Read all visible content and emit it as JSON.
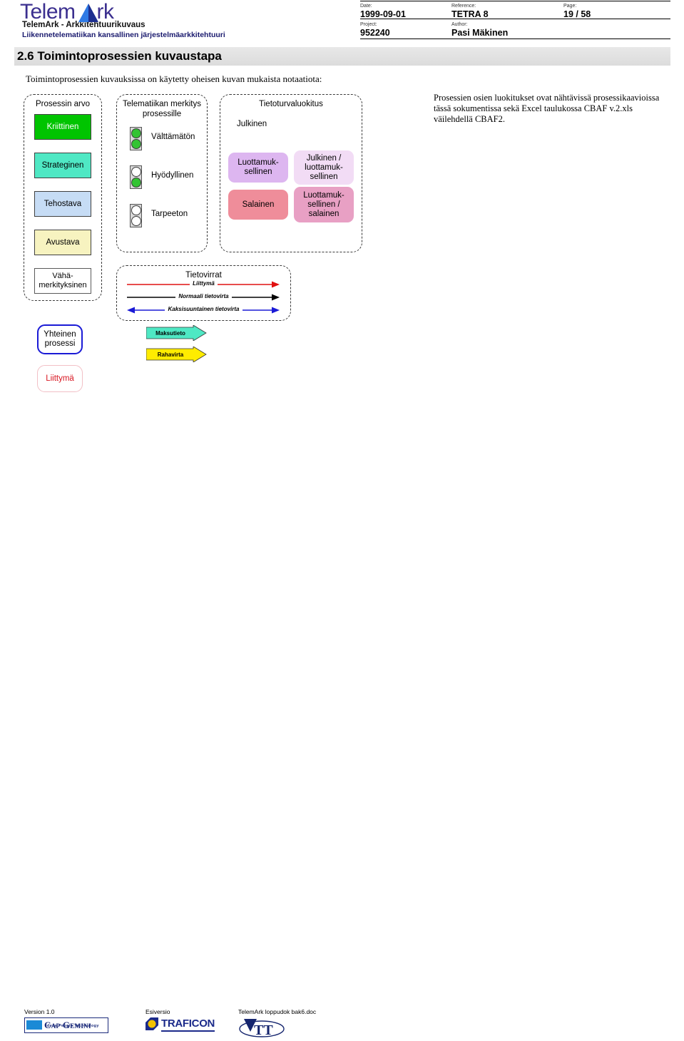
{
  "header": {
    "logo": {
      "wordmark_pre": "Telem",
      "wordmark_post": "rk",
      "pyramid_icon": "pyramid-icon",
      "subtitle_1": "TelemArk - Arkkitehtuurikuvaus",
      "subtitle_2": "Liikennetelematiikan kansallinen järjestelmäarkkitehtuuri"
    },
    "meta": {
      "date_label": "Date:",
      "date_value": "1999-09-01",
      "reference_label": "Reference:",
      "reference_value": "TETRA 8",
      "page_label": "Page:",
      "page_value": "19 / 58",
      "project_label": "Project:",
      "project_value": "952240",
      "author_label": "Author:",
      "author_value": "Pasi Mäkinen"
    }
  },
  "section": {
    "title": "2.6 Toimintoprosessien kuvaustapa",
    "intro": "Toimintoprosessien kuvauksissa on käytetty oheisen kuvan mukaista notaatiota:",
    "side_note": "Prosessien osien luokitukset ovat nähtävissä prosessikaavioissa tässä sokumentissa sekä Excel taulukossa CBAF v.2.xls väilehdellä CBAF2."
  },
  "legend": {
    "process_value": {
      "title": "Prosessin arvo",
      "items": [
        {
          "label": "Kriittinen",
          "bg": "#00c400",
          "fg": "#ffffff"
        },
        {
          "label": "Strateginen",
          "bg": "#4fe8c4",
          "fg": "#000000"
        },
        {
          "label": "Tehostava",
          "bg": "#c6dcf5",
          "fg": "#000000"
        },
        {
          "label": "Avustava",
          "bg": "#f7f3c0",
          "fg": "#000000"
        },
        {
          "label": "Vähä-\nmerkityksinen",
          "bg": "#ffffff",
          "fg": "#000000"
        }
      ],
      "item_0": "Kriittinen",
      "item_1": "Strateginen",
      "item_2": "Tehostava",
      "item_3": "Avustava",
      "item_4_line1": "Vähä-",
      "item_4_line2": "merkityksinen"
    },
    "telematics_significance": {
      "title_line1": "Telematiikan merkitys",
      "title_line2": "prosessille",
      "items": [
        {
          "label": "Välttämätön",
          "top_lamp": "green",
          "bottom_lamp": "green"
        },
        {
          "label": "Hyödyllinen",
          "top_lamp": "white",
          "bottom_lamp": "green"
        },
        {
          "label": "Tarpeeton",
          "top_lamp": "white",
          "bottom_lamp": "white"
        }
      ],
      "item_0": "Välttämätön",
      "item_1": "Hyödyllinen",
      "item_2": "Tarpeeton"
    },
    "security_classification": {
      "title": "Tietoturvaluokitus",
      "plain": "Julkinen",
      "boxes": [
        {
          "label": "Luottamuk-sellinen",
          "bg": "#ddb6f0"
        },
        {
          "label": "Julkinen / luottamuk-sellinen",
          "bg": "#f2dcf5"
        },
        {
          "label": "Salainen",
          "bg": "#ef8d9a"
        },
        {
          "label": "Luottamuk-sellinen / salainen",
          "bg": "#e8a0c4"
        }
      ],
      "luottamuksellinen_l1": "Luottamuk-",
      "luottamuksellinen_l2": "sellinen",
      "julkinen_luott_l1": "Julkinen /",
      "julkinen_luott_l2": "luottamuk-",
      "julkinen_luott_l3": "sellinen",
      "salainen": "Salainen",
      "luott_salainen_l1": "Luottamuk-",
      "luott_salainen_l2": "sellinen /",
      "luott_salainen_l3": "salainen"
    },
    "data_flows": {
      "title": "Tietovirrat",
      "items": [
        {
          "label": "Liittymä",
          "color": "#e01010",
          "direction": "right"
        },
        {
          "label": "Normaali tietovirta",
          "color": "#000000",
          "direction": "right"
        },
        {
          "label": "Kaksisuuntainen tietovirta",
          "color": "#1a1ad6",
          "direction": "both"
        }
      ],
      "item_0": "Liittymä",
      "item_1": "Normaali tietovirta",
      "item_2": "Kaksisuuntainen tietovirta"
    },
    "process_shapes": {
      "shared_process_l1": "Yhteinen",
      "shared_process_l2": "prosessi",
      "interface": "Liittymä",
      "shared_process_border": "#1a1ad6",
      "interface_border": "#f2c0c6",
      "interface_text_color": "#d81520"
    },
    "flow_banners": {
      "items": [
        {
          "label": "Maksutieto",
          "bg": "#4fe8c4"
        },
        {
          "label": "Rahavirta",
          "bg": "#ffec00"
        }
      ],
      "item_0": "Maksutieto",
      "item_1": "Rahavirta"
    }
  },
  "footer": {
    "version_caption": "Version 1.0",
    "capgemini_name": "Cap Gemini",
    "capgemini_tagline": "ideas People Technology",
    "esiversio_caption": "Esiversio",
    "traficon_name": "TRAFICON",
    "doc_caption": "TelemArk loppudok bak6.doc",
    "vtt_name": "VTT"
  }
}
